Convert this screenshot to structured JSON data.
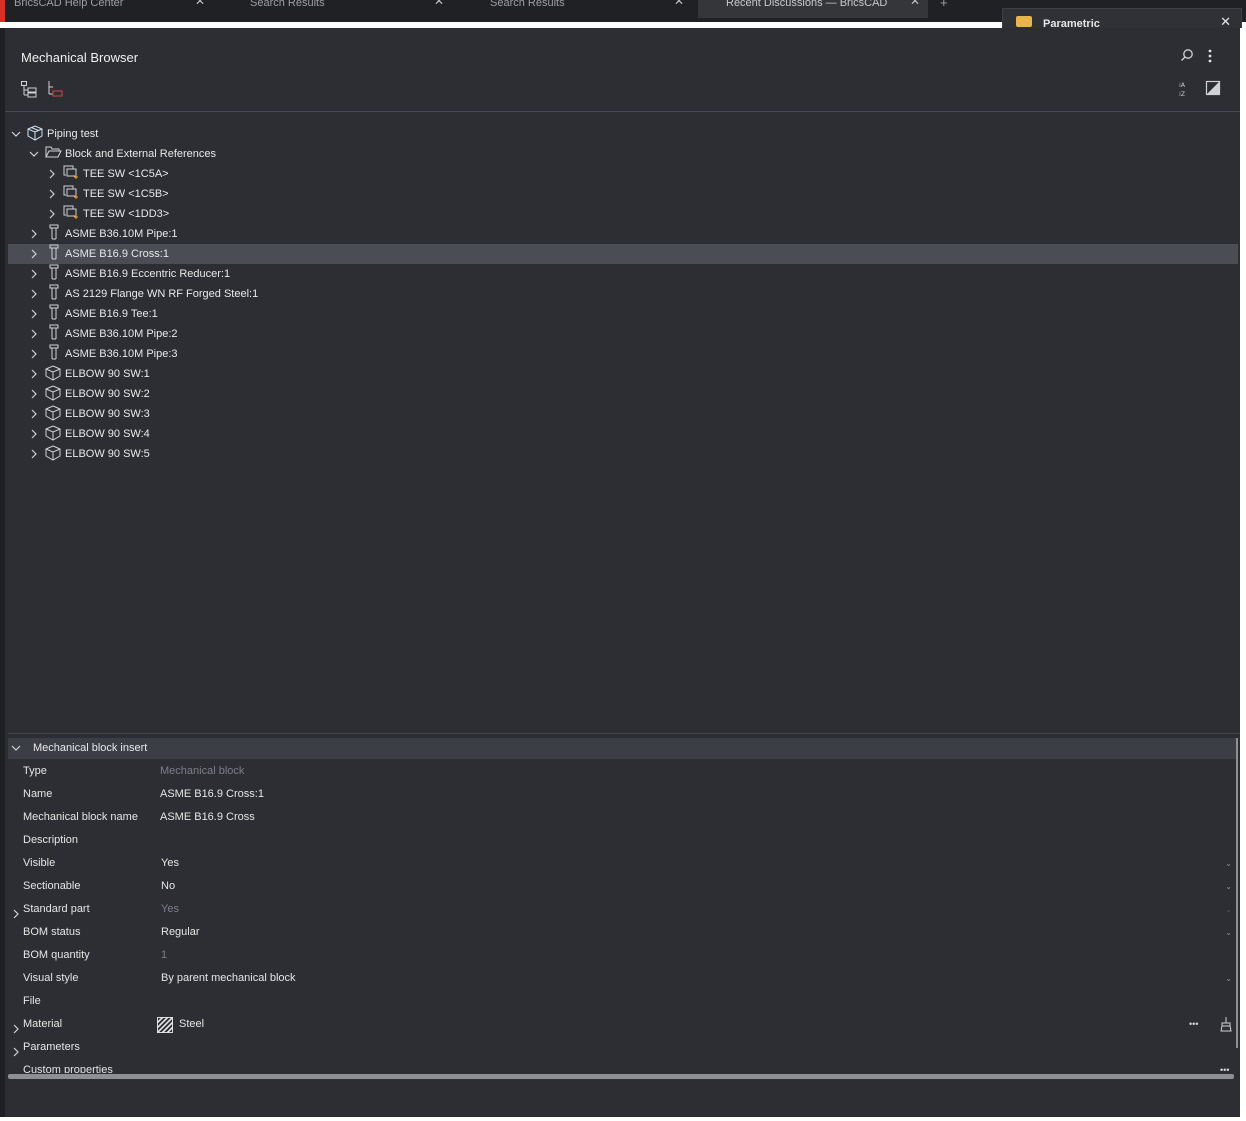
{
  "browser_tabs": [
    {
      "label": "BricsCAD Help Center",
      "close": "✕"
    },
    {
      "label": "Search Results",
      "close": "✕"
    },
    {
      "label": "Search Results",
      "close": "✕"
    },
    {
      "label": "Recent Discussions — BricsCAD",
      "close": "✕",
      "active": true
    }
  ],
  "new_tab": "+",
  "parametric_panel": {
    "title": "Parametric",
    "close": "✕"
  },
  "panel": {
    "title": "Mechanical Browser",
    "icons": [
      "search-icon",
      "more-vertical-icon",
      "tree-view-icon",
      "tree-filter-icon",
      "sort-az-icon",
      "visual-style-icon"
    ]
  },
  "tree": [
    {
      "label": "Piping test",
      "level": 0,
      "expanded": true,
      "icon": "assembly-icon"
    },
    {
      "label": "Block and External References",
      "level": 1,
      "expanded": true,
      "icon": "folder-open-icon"
    },
    {
      "label": "TEE SW <1C5A>",
      "level": 2,
      "icon": "block-reference-icon"
    },
    {
      "label": "TEE SW <1C5B>",
      "level": 2,
      "icon": "block-reference-icon"
    },
    {
      "label": "TEE SW <1DD3>",
      "level": 2,
      "icon": "block-reference-icon"
    },
    {
      "label": "ASME B36.10M Pipe:1",
      "level": 1,
      "icon": "standard-part-icon"
    },
    {
      "label": "ASME B16.9 Cross:1",
      "level": 1,
      "icon": "standard-part-icon",
      "selected": true
    },
    {
      "label": "ASME B16.9 Eccentric Reducer:1",
      "level": 1,
      "icon": "standard-part-icon"
    },
    {
      "label": "AS 2129 Flange WN RF Forged Steel:1",
      "level": 1,
      "icon": "standard-part-icon"
    },
    {
      "label": "ASME B16.9 Tee:1",
      "level": 1,
      "icon": "standard-part-icon"
    },
    {
      "label": "ASME B36.10M Pipe:2",
      "level": 1,
      "icon": "standard-part-icon"
    },
    {
      "label": "ASME B36.10M Pipe:3",
      "level": 1,
      "icon": "standard-part-icon"
    },
    {
      "label": "ELBOW 90 SW:1",
      "level": 1,
      "icon": "component-icon"
    },
    {
      "label": "ELBOW 90 SW:2",
      "level": 1,
      "icon": "component-icon"
    },
    {
      "label": "ELBOW 90 SW:3",
      "level": 1,
      "icon": "component-icon"
    },
    {
      "label": "ELBOW 90 SW:4",
      "level": 1,
      "icon": "component-icon"
    },
    {
      "label": "ELBOW 90 SW:5",
      "level": 1,
      "icon": "component-icon"
    }
  ],
  "properties": {
    "section_title": "Mechanical block insert",
    "rows": [
      {
        "key": "Type",
        "value": "Mechanical block",
        "dim": true
      },
      {
        "key": "Name",
        "value": "ASME B16.9 Cross:1"
      },
      {
        "key": "Mechanical block name",
        "value": "ASME B16.9 Cross"
      },
      {
        "key": "Description",
        "value": ""
      },
      {
        "key": "Visible",
        "value": "Yes",
        "dropdown": true
      },
      {
        "key": "Sectionable",
        "value": "No",
        "dropdown": true
      },
      {
        "key": "Standard part",
        "value": "Yes",
        "dim": true,
        "expandable": true
      },
      {
        "key": "BOM status",
        "value": "Regular",
        "dropdown": true
      },
      {
        "key": "BOM quantity",
        "value": "1",
        "dim": true
      },
      {
        "key": "Visual style",
        "value": "By parent mechanical block",
        "dropdown": true
      },
      {
        "key": "File",
        "value": ""
      },
      {
        "key": "Material",
        "value": "Steel",
        "expandable": true,
        "material": true
      },
      {
        "key": "Parameters",
        "value": "",
        "expandable": true
      },
      {
        "key": "Custom properties",
        "value": "",
        "more": true
      }
    ],
    "more_label": "•••"
  }
}
